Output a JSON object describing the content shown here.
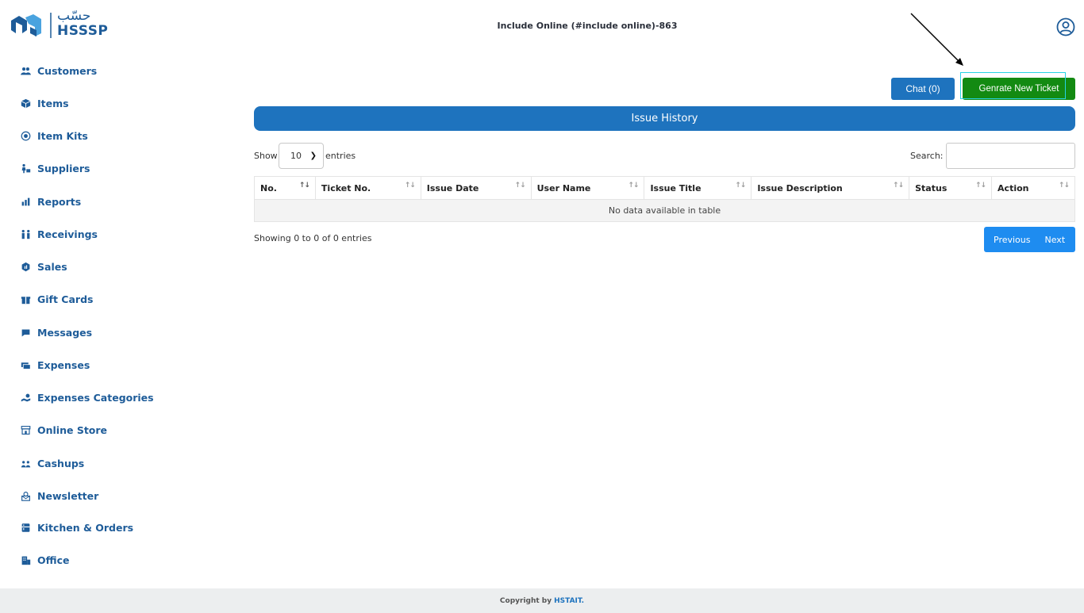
{
  "brand": {
    "logo_arabic": "حسّب",
    "logo_latin": "HSSSP",
    "logo_icon": "hsssp-logo-mark"
  },
  "header": {
    "title": "Include Online (#include online)-863",
    "user_icon": "user-circle-icon"
  },
  "sidebar": {
    "items": [
      {
        "label": "Customers",
        "icon": "users-icon"
      },
      {
        "label": "Items",
        "icon": "box-icon"
      },
      {
        "label": "Item Kits",
        "icon": "kit-icon"
      },
      {
        "label": "Suppliers",
        "icon": "supplier-icon"
      },
      {
        "label": "Reports",
        "icon": "chart-icon"
      },
      {
        "label": "Receivings",
        "icon": "receiving-icon"
      },
      {
        "label": "Sales",
        "icon": "sales-icon"
      },
      {
        "label": "Gift Cards",
        "icon": "gift-icon"
      },
      {
        "label": "Messages",
        "icon": "message-icon"
      },
      {
        "label": "Expenses",
        "icon": "expenses-icon"
      },
      {
        "label": "Expenses Categories",
        "icon": "expense-category-icon"
      },
      {
        "label": "Online Store",
        "icon": "store-icon"
      },
      {
        "label": "Cashups",
        "icon": "cashup-icon"
      },
      {
        "label": "Newsletter",
        "icon": "newsletter-icon"
      },
      {
        "label": "Kitchen & Orders",
        "icon": "kitchen-icon"
      },
      {
        "label": "Office",
        "icon": "office-icon"
      }
    ]
  },
  "actions": {
    "chat_label": "Chat (0)",
    "generate_label": "Genrate New Ticket"
  },
  "panel": {
    "title": "Issue History"
  },
  "table_controls": {
    "show_label": "Show",
    "length_value": "10",
    "entries_label": "entries",
    "search_label": "Search:",
    "search_value": ""
  },
  "table": {
    "columns": [
      "No.",
      "Ticket No.",
      "Issue Date",
      "User Name",
      "Issue Title",
      "Issue Description",
      "Status",
      "Action"
    ],
    "empty_message": "No data available in table",
    "info": "Showing 0 to 0 of 0 entries"
  },
  "pagination": {
    "previous": "Previous",
    "next": "Next"
  },
  "footer": {
    "prefix": "Copyright by",
    "brand": "HSTAIT."
  },
  "colors": {
    "primary": "#1e73be",
    "nav_text": "#1e5c99",
    "success": "#138a12",
    "pager": "#1e8cf0",
    "highlight": "#27d3e6"
  }
}
